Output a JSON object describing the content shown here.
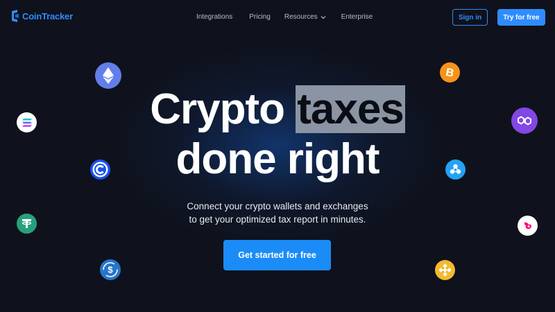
{
  "brand": {
    "name": "CoinTracker",
    "color": "#2f8cff"
  },
  "nav": {
    "items": [
      {
        "label": "Integrations"
      },
      {
        "label": "Pricing"
      },
      {
        "label": "Resources"
      },
      {
        "label": "Enterprise"
      }
    ]
  },
  "header": {
    "sign_in": "Sign in",
    "try_free": "Try for free"
  },
  "hero": {
    "title_word1": "Crypto",
    "title_word2": "taxes",
    "title_line2": "done right",
    "subtitle_line1": "Connect your crypto wallets and exchanges",
    "subtitle_line2": "to get your optimized tax report in minutes.",
    "cta": "Get started for free"
  },
  "coins": [
    {
      "name": "ethereum-icon",
      "color": "#627eea"
    },
    {
      "name": "solana-icon",
      "color": "#ffffff"
    },
    {
      "name": "cro-icon",
      "color": "#1652f0"
    },
    {
      "name": "tether-icon",
      "color": "#26a17b"
    },
    {
      "name": "usdc-icon",
      "color": "#2775ca"
    },
    {
      "name": "bitcoin-icon",
      "color": "#f7931a"
    },
    {
      "name": "polygon-icon",
      "color": "#8247e5"
    },
    {
      "name": "ripple-icon",
      "color": "#23a2f6"
    },
    {
      "name": "uniswap-icon",
      "color": "#ffffff"
    },
    {
      "name": "bnb-icon",
      "color": "#f3ba2f"
    }
  ],
  "colors": {
    "background": "#0f121c",
    "accent": "#1b8cf7",
    "highlight": "#8b94a3"
  }
}
